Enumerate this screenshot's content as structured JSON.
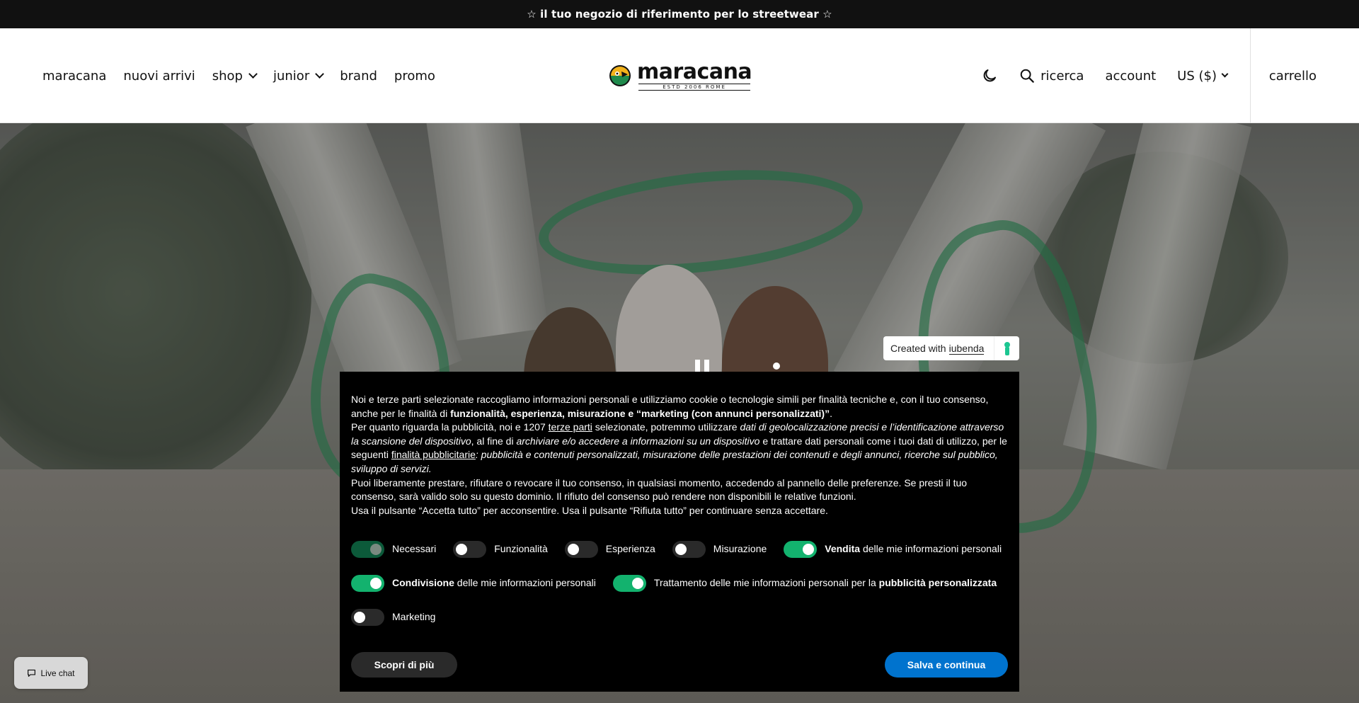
{
  "announcement": "☆ il tuo negozio di riferimento per lo streetwear ☆",
  "nav": {
    "items": [
      {
        "label": "maracana",
        "dropdown": false
      },
      {
        "label": "nuovi arrivi",
        "dropdown": false
      },
      {
        "label": "shop",
        "dropdown": true
      },
      {
        "label": "junior",
        "dropdown": true
      },
      {
        "label": "brand",
        "dropdown": false
      },
      {
        "label": "promo",
        "dropdown": false
      }
    ]
  },
  "logo": {
    "word": "maracana",
    "tagline": "ESTD 2006 ROME"
  },
  "header_right": {
    "theme_icon": "moon-icon",
    "search_label": "ricerca",
    "account_label": "account",
    "currency_label": "US ($)",
    "cart_label": "carrello"
  },
  "hero": {
    "slider_state": "paused"
  },
  "iubenda_badge": {
    "prefix": "Created with",
    "brand": "iubenda"
  },
  "consent": {
    "p1_a": "Noi e terze parti selezionate raccogliamo informazioni personali e utilizziamo cookie o tecnologie simili per finalità tecniche e, con il tuo consenso, anche per le finalità di ",
    "p1_b": "funzionalità, esperienza, misurazione e “marketing (con annunci personalizzati)”",
    "p1_c": ".",
    "p2_a": "Per quanto riguarda la pubblicità, noi e 1207 ",
    "p2_link": "terze parti",
    "p2_b": " selezionate, potremmo utilizzare ",
    "p2_i1": "dati di geolocalizzazione precisi e l’identificazione attraverso la scansione del dispositivo",
    "p2_c": ", al fine di ",
    "p2_i2": "archiviare e/o accedere a informazioni su un dispositivo",
    "p2_d": " e trattare dati personali come i tuoi dati di utilizzo, per le seguenti ",
    "p2_link2": "finalità pubblicitarie",
    "p2_i3": ": pubblicità e contenuti personalizzati, misurazione delle prestazioni dei contenuti e degli annunci, ricerche sul pubblico, sviluppo di servizi.",
    "p3": "Puoi liberamente prestare, rifiutare o revocare il tuo consenso, in qualsiasi momento, accedendo al pannello delle preferenze. Se presti il tuo consenso, sarà valido solo su questo dominio. Il rifiuto del consenso può rendere non disponibili le relative funzioni.",
    "p4": "Usa il pulsante “Accetta tutto” per acconsentire. Usa il pulsante “Rifiuta tutto” per continuare senza accettare.",
    "toggles": {
      "necessari": {
        "label": "Necessari",
        "state": "locked-on"
      },
      "funzionalita": {
        "label": "Funzionalità",
        "state": "off"
      },
      "esperienza": {
        "label": "Esperienza",
        "state": "off"
      },
      "misurazione": {
        "label": "Misurazione",
        "state": "off"
      },
      "vendita": {
        "bold": "Vendita",
        "rest": " delle mie informazioni personali",
        "state": "on"
      },
      "condivisione": {
        "bold": "Condivisione",
        "rest": " delle mie informazioni personali",
        "state": "on"
      },
      "trattamento": {
        "rest": "Trattamento delle mie informazioni personali per la ",
        "bold": "pubblicità personalizzata",
        "state": "on"
      },
      "marketing": {
        "label": "Marketing",
        "state": "off"
      }
    },
    "learn_more": "Scopri di più",
    "save": "Salva e continua"
  },
  "livechat": {
    "label": "Live chat"
  }
}
